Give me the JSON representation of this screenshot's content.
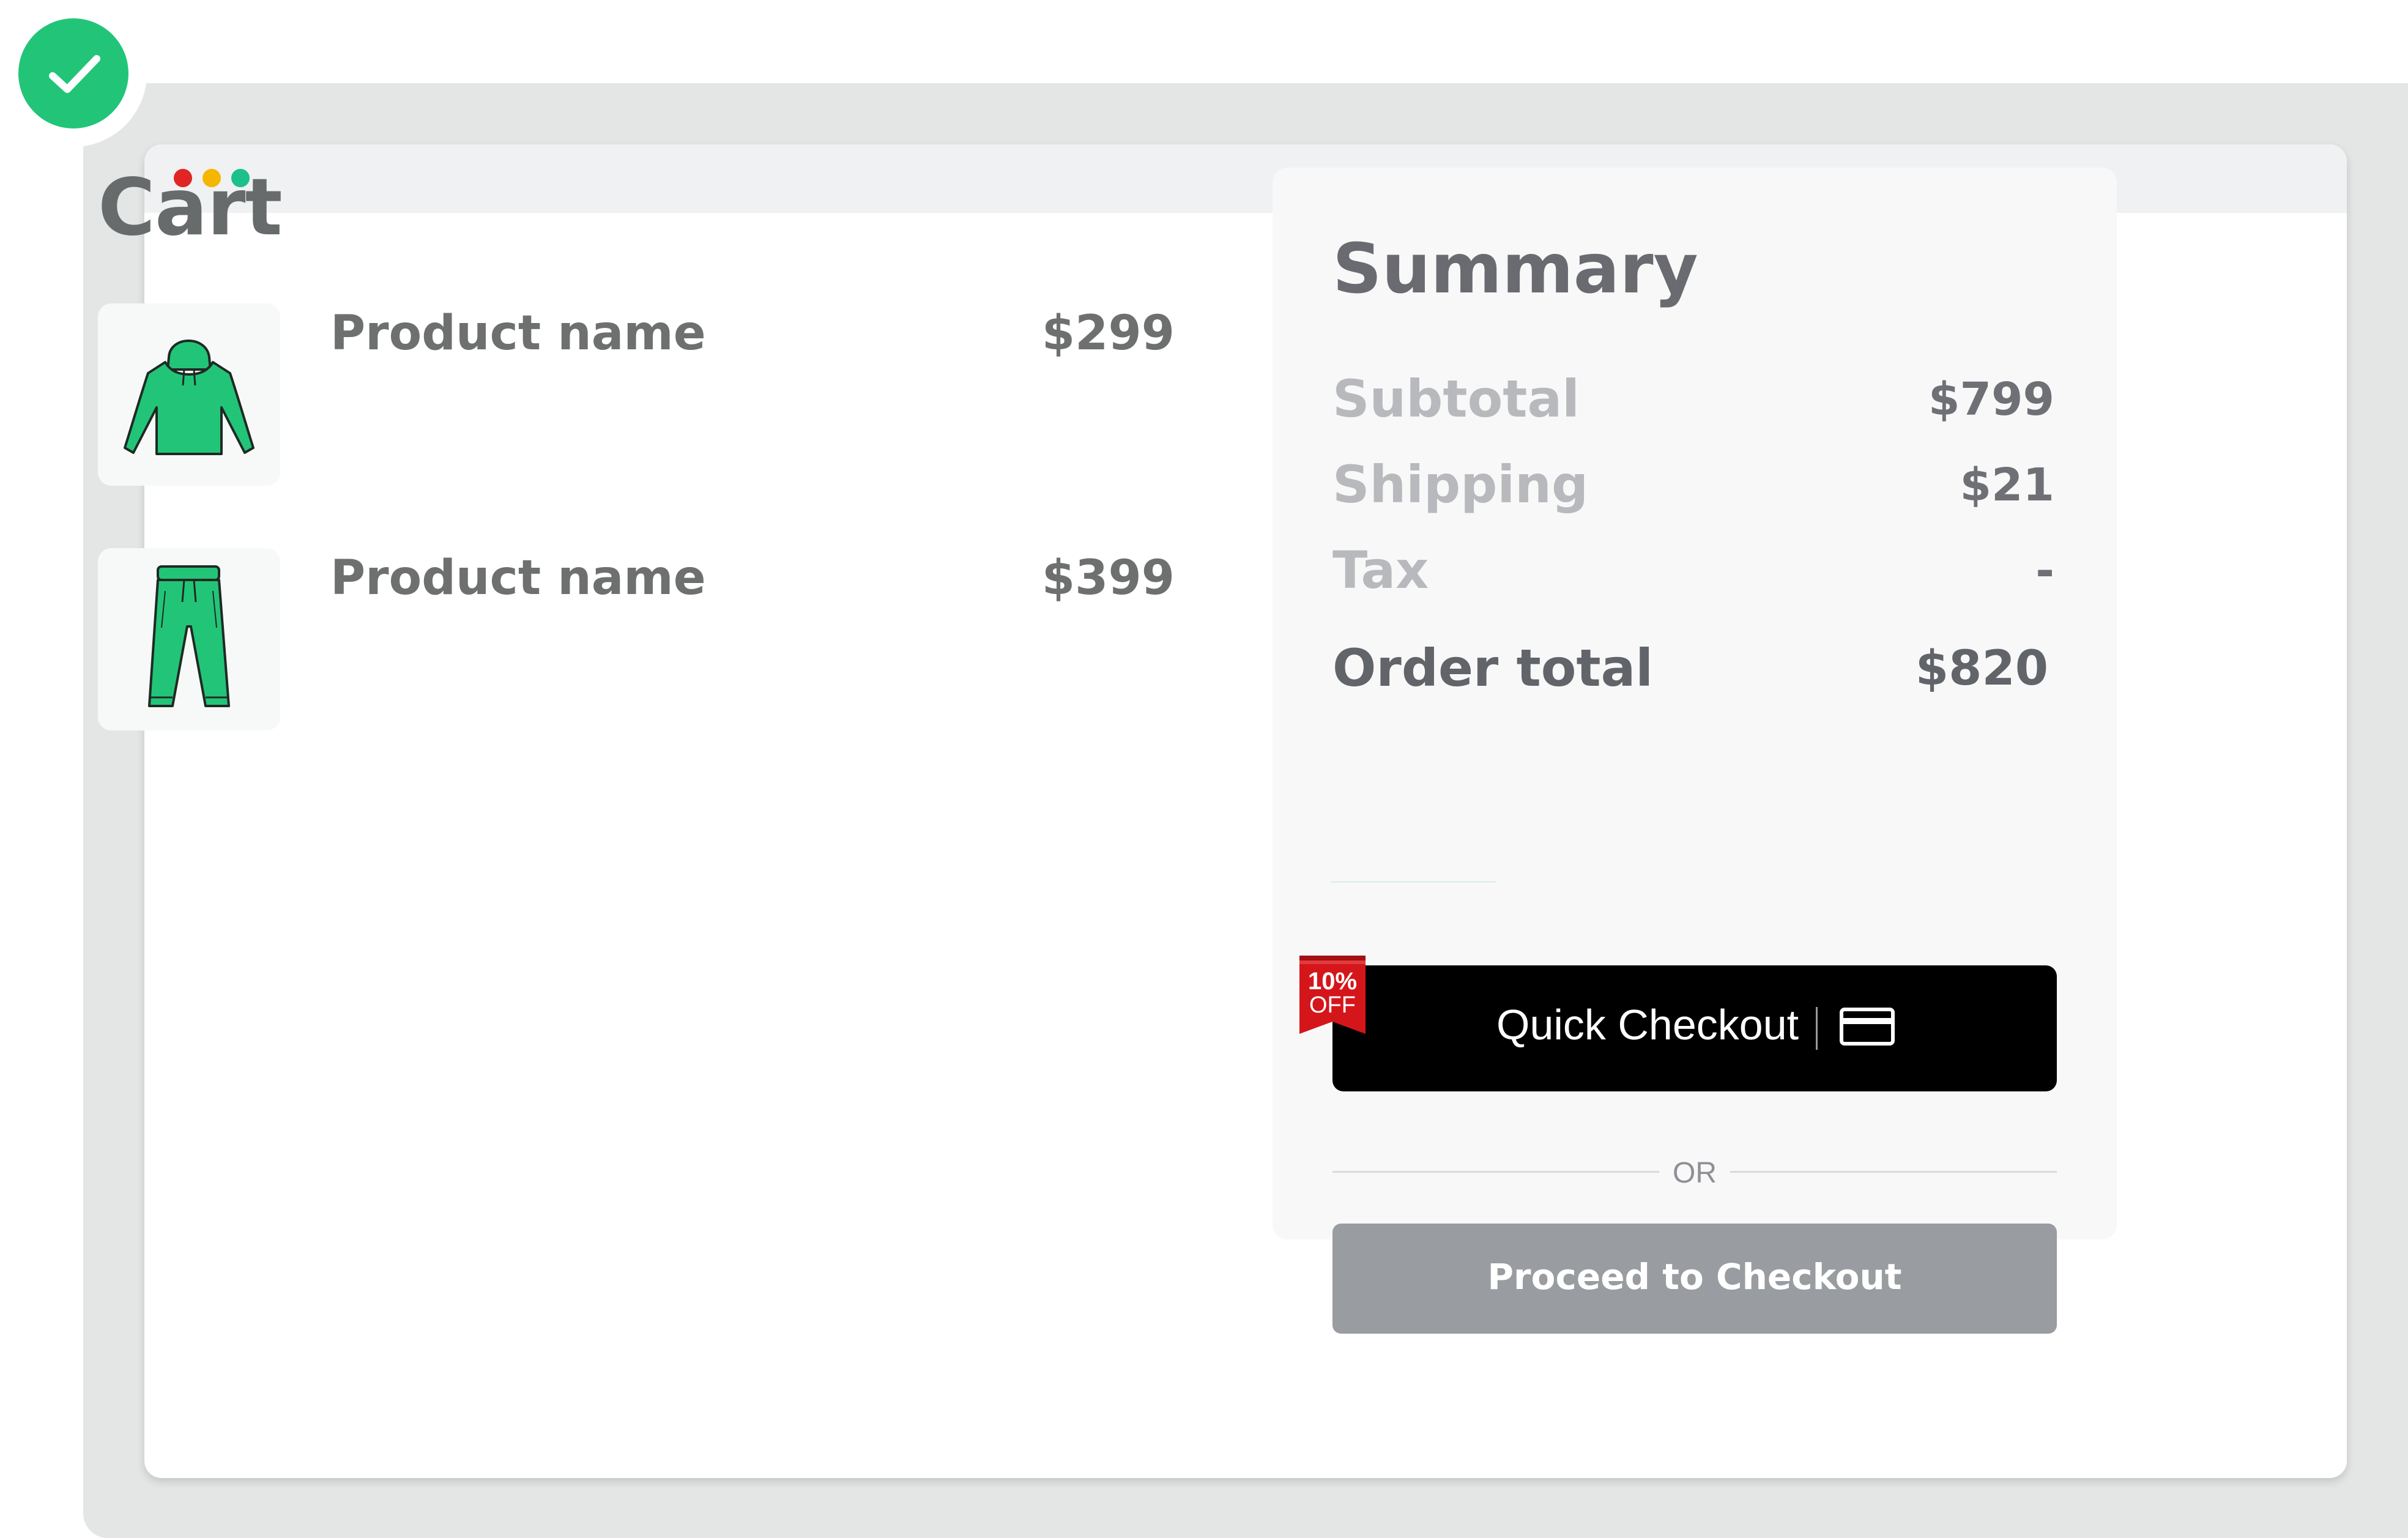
{
  "cart": {
    "title": "Cart",
    "items": [
      {
        "name": "Product name",
        "price": "$299",
        "image": "hoodie-icon"
      },
      {
        "name": "Product name",
        "price": "$399",
        "image": "sweatpants-icon"
      }
    ]
  },
  "summary": {
    "title": "Summary",
    "rows": [
      {
        "label": "Subtotal",
        "value": "$799"
      },
      {
        "label": "Shipping",
        "value": "$21"
      },
      {
        "label": "Tax",
        "value": "-"
      }
    ],
    "order_total": {
      "label": "Order total",
      "value": "$820"
    },
    "quick_checkout": {
      "label": "Quick Checkout",
      "badge_line1": "10%",
      "badge_line2": "OFF",
      "icon": "credit-card-icon"
    },
    "divider_text": "OR",
    "proceed_label": "Proceed to Checkout"
  },
  "colors": {
    "success_green": "#22c578",
    "product_green": "#22c578",
    "quick_button_bg": "#000000",
    "proceed_button_bg": "#999ca1",
    "badge_red": "#d4161b"
  }
}
